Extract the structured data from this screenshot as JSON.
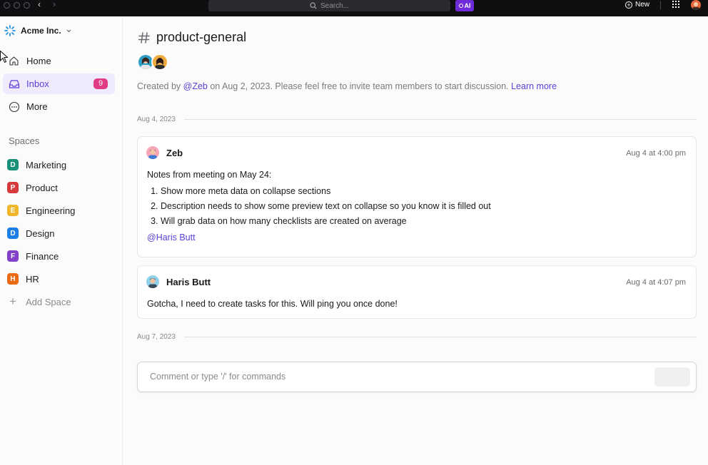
{
  "topbar": {
    "search_placeholder": "Search...",
    "ai_label": "AI",
    "new_label": "New"
  },
  "sidebar": {
    "workspace_name": "Acme Inc.",
    "nav": [
      {
        "label": "Home"
      },
      {
        "label": "Inbox",
        "badge": "9"
      },
      {
        "label": "More"
      }
    ],
    "spaces_title": "Spaces",
    "spaces": [
      {
        "letter": "D",
        "label": "Marketing",
        "color": "#17907a"
      },
      {
        "letter": "P",
        "label": "Product",
        "color": "#d8393c"
      },
      {
        "letter": "E",
        "label": "Engineering",
        "color": "#f0b72b"
      },
      {
        "letter": "D",
        "label": "Design",
        "color": "#1a7fe6"
      },
      {
        "letter": "F",
        "label": "Finance",
        "color": "#8340c9"
      },
      {
        "letter": "H",
        "label": "HR",
        "color": "#ec6a14"
      }
    ],
    "add_space_label": "Add Space"
  },
  "main": {
    "channel_name": "product-general",
    "intro": {
      "prefix": "Created by ",
      "mention": "@Zeb",
      "middle": " on Aug 2, 2023. Please feel free to invite team members to start discussion. ",
      "link": "Learn more"
    },
    "date_1": "Aug 4, 2023",
    "messages": [
      {
        "author": "Zeb",
        "time": "Aug 4 at 4:00 pm",
        "text": "Notes from meeting on May 24:",
        "list": [
          "Show more meta data on collapse sections",
          "Description needs to show some preview text on collapse so you know it is filled out",
          "Will grab data on how many checklists are created on average"
        ],
        "mention": "@Haris Butt"
      },
      {
        "author": "Haris Butt",
        "time": "Aug 4 at 4:07 pm",
        "text": "Gotcha, I need to create tasks for this. Will ping you once done!"
      }
    ],
    "date_2": "Aug 7, 2023",
    "comment_placeholder": "Comment or type '/' for commands"
  },
  "colors": {
    "accent": "#5b3fd6",
    "inbox_bg": "#efeafc",
    "badge": "#e03b83",
    "ai_chip": "#6f2bd9"
  }
}
